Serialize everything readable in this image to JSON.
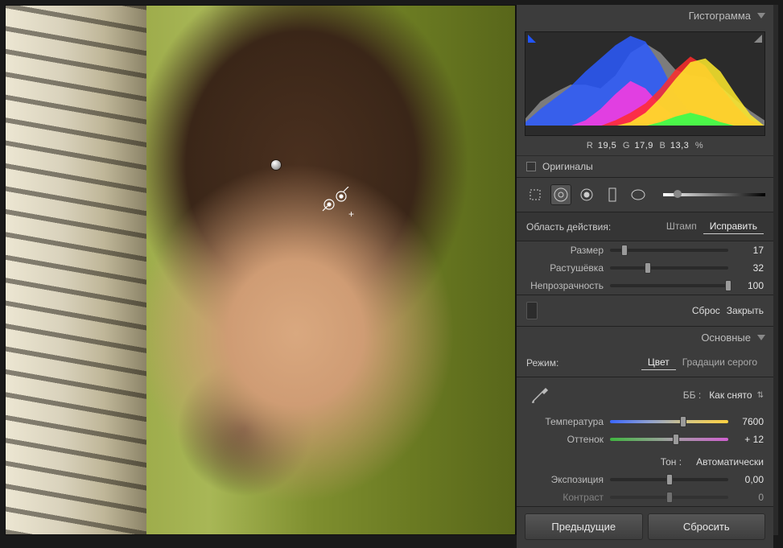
{
  "histogram": {
    "title": "Гистограмма",
    "readout": {
      "r_label": "R",
      "r": "19,5",
      "g_label": "G",
      "g": "17,9",
      "b_label": "B",
      "b": "13,3",
      "pct": "%"
    },
    "originals_label": "Оригиналы"
  },
  "tools": {
    "crop": "crop",
    "spot": "spot",
    "redeye": "redeye",
    "gradient": "gradient",
    "radial": "radial",
    "brush": "brush"
  },
  "spot_panel": {
    "area_label": "Область действия:",
    "mode_clone": "Штамп",
    "mode_heal": "Исправить",
    "size_label": "Размер",
    "size_value": "17",
    "feather_label": "Растушёвка",
    "feather_value": "32",
    "opacity_label": "Непрозрачность",
    "opacity_value": "100",
    "reset": "Сброс",
    "close": "Закрыть"
  },
  "basic": {
    "title": "Основные",
    "treatment_label": "Режим:",
    "treatment_color": "Цвет",
    "treatment_bw": "Градации серого",
    "wb_label": "ББ :",
    "wb_preset": "Как снято",
    "temp_label": "Температура",
    "temp_value": "7600",
    "tint_label": "Оттенок",
    "tint_value": "+ 12",
    "tone_label": "Тон :",
    "auto": "Автоматически",
    "exposure_label": "Экспозиция",
    "exposure_value": "0,00",
    "contrast_label": "Контраст",
    "contrast_value": "0"
  },
  "footer": {
    "previous": "Предыдущие",
    "reset": "Сбросить"
  },
  "chart_data": {
    "type": "area",
    "title": "Гистограмма",
    "xlabel": "",
    "ylabel": "",
    "xlim": [
      0,
      255
    ],
    "ylim": [
      0,
      100
    ],
    "x": [
      0,
      16,
      32,
      48,
      64,
      80,
      96,
      112,
      128,
      144,
      160,
      176,
      192,
      208,
      224,
      240,
      255
    ],
    "series": [
      {
        "name": "luminance",
        "color": "#bfbfbf",
        "values": [
          8,
          26,
          36,
          44,
          44,
          40,
          54,
          78,
          88,
          78,
          60,
          54,
          52,
          42,
          28,
          16,
          6
        ]
      },
      {
        "name": "blue",
        "color": "#2b5bff",
        "values": [
          4,
          18,
          30,
          42,
          58,
          72,
          86,
          96,
          90,
          66,
          34,
          14,
          6,
          2,
          0,
          0,
          0
        ]
      },
      {
        "name": "magenta",
        "color": "#ff3adf",
        "values": [
          0,
          0,
          0,
          0,
          6,
          18,
          34,
          48,
          40,
          22,
          10,
          4,
          0,
          0,
          0,
          0,
          0
        ]
      },
      {
        "name": "red",
        "color": "#ff2b2b",
        "values": [
          0,
          0,
          0,
          0,
          0,
          0,
          6,
          14,
          24,
          40,
          60,
          74,
          64,
          42,
          22,
          6,
          0
        ]
      },
      {
        "name": "yellow",
        "color": "#ffeb2b",
        "values": [
          0,
          0,
          0,
          0,
          0,
          0,
          0,
          4,
          14,
          30,
          50,
          68,
          72,
          58,
          34,
          12,
          0
        ]
      },
      {
        "name": "green",
        "color": "#2bff4d",
        "values": [
          0,
          0,
          0,
          0,
          0,
          0,
          0,
          0,
          0,
          4,
          10,
          14,
          10,
          4,
          0,
          0,
          0
        ]
      }
    ]
  }
}
